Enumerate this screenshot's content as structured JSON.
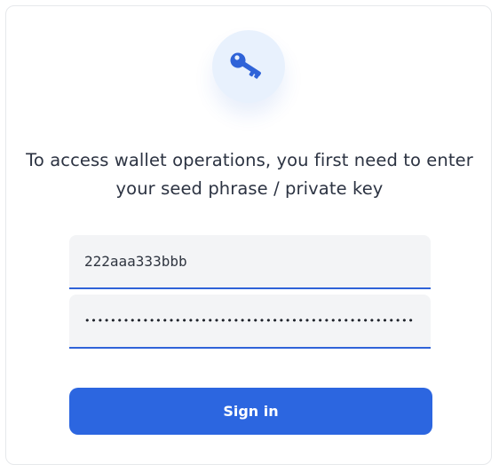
{
  "icon": {
    "name": "key-icon",
    "color": "#2f63d8",
    "background": "#e8f1fd"
  },
  "prompt": {
    "line1": "To access wallet operations, you first need to enter",
    "line2": "your seed phrase / private key"
  },
  "form": {
    "seed_value": "222aaa333bbb",
    "password_value": "••••••••••••••••••••••••••••••••••••••••••••••••••••••••••"
  },
  "actions": {
    "signin_label": "Sign in",
    "signin_color": "#2c66e0"
  }
}
